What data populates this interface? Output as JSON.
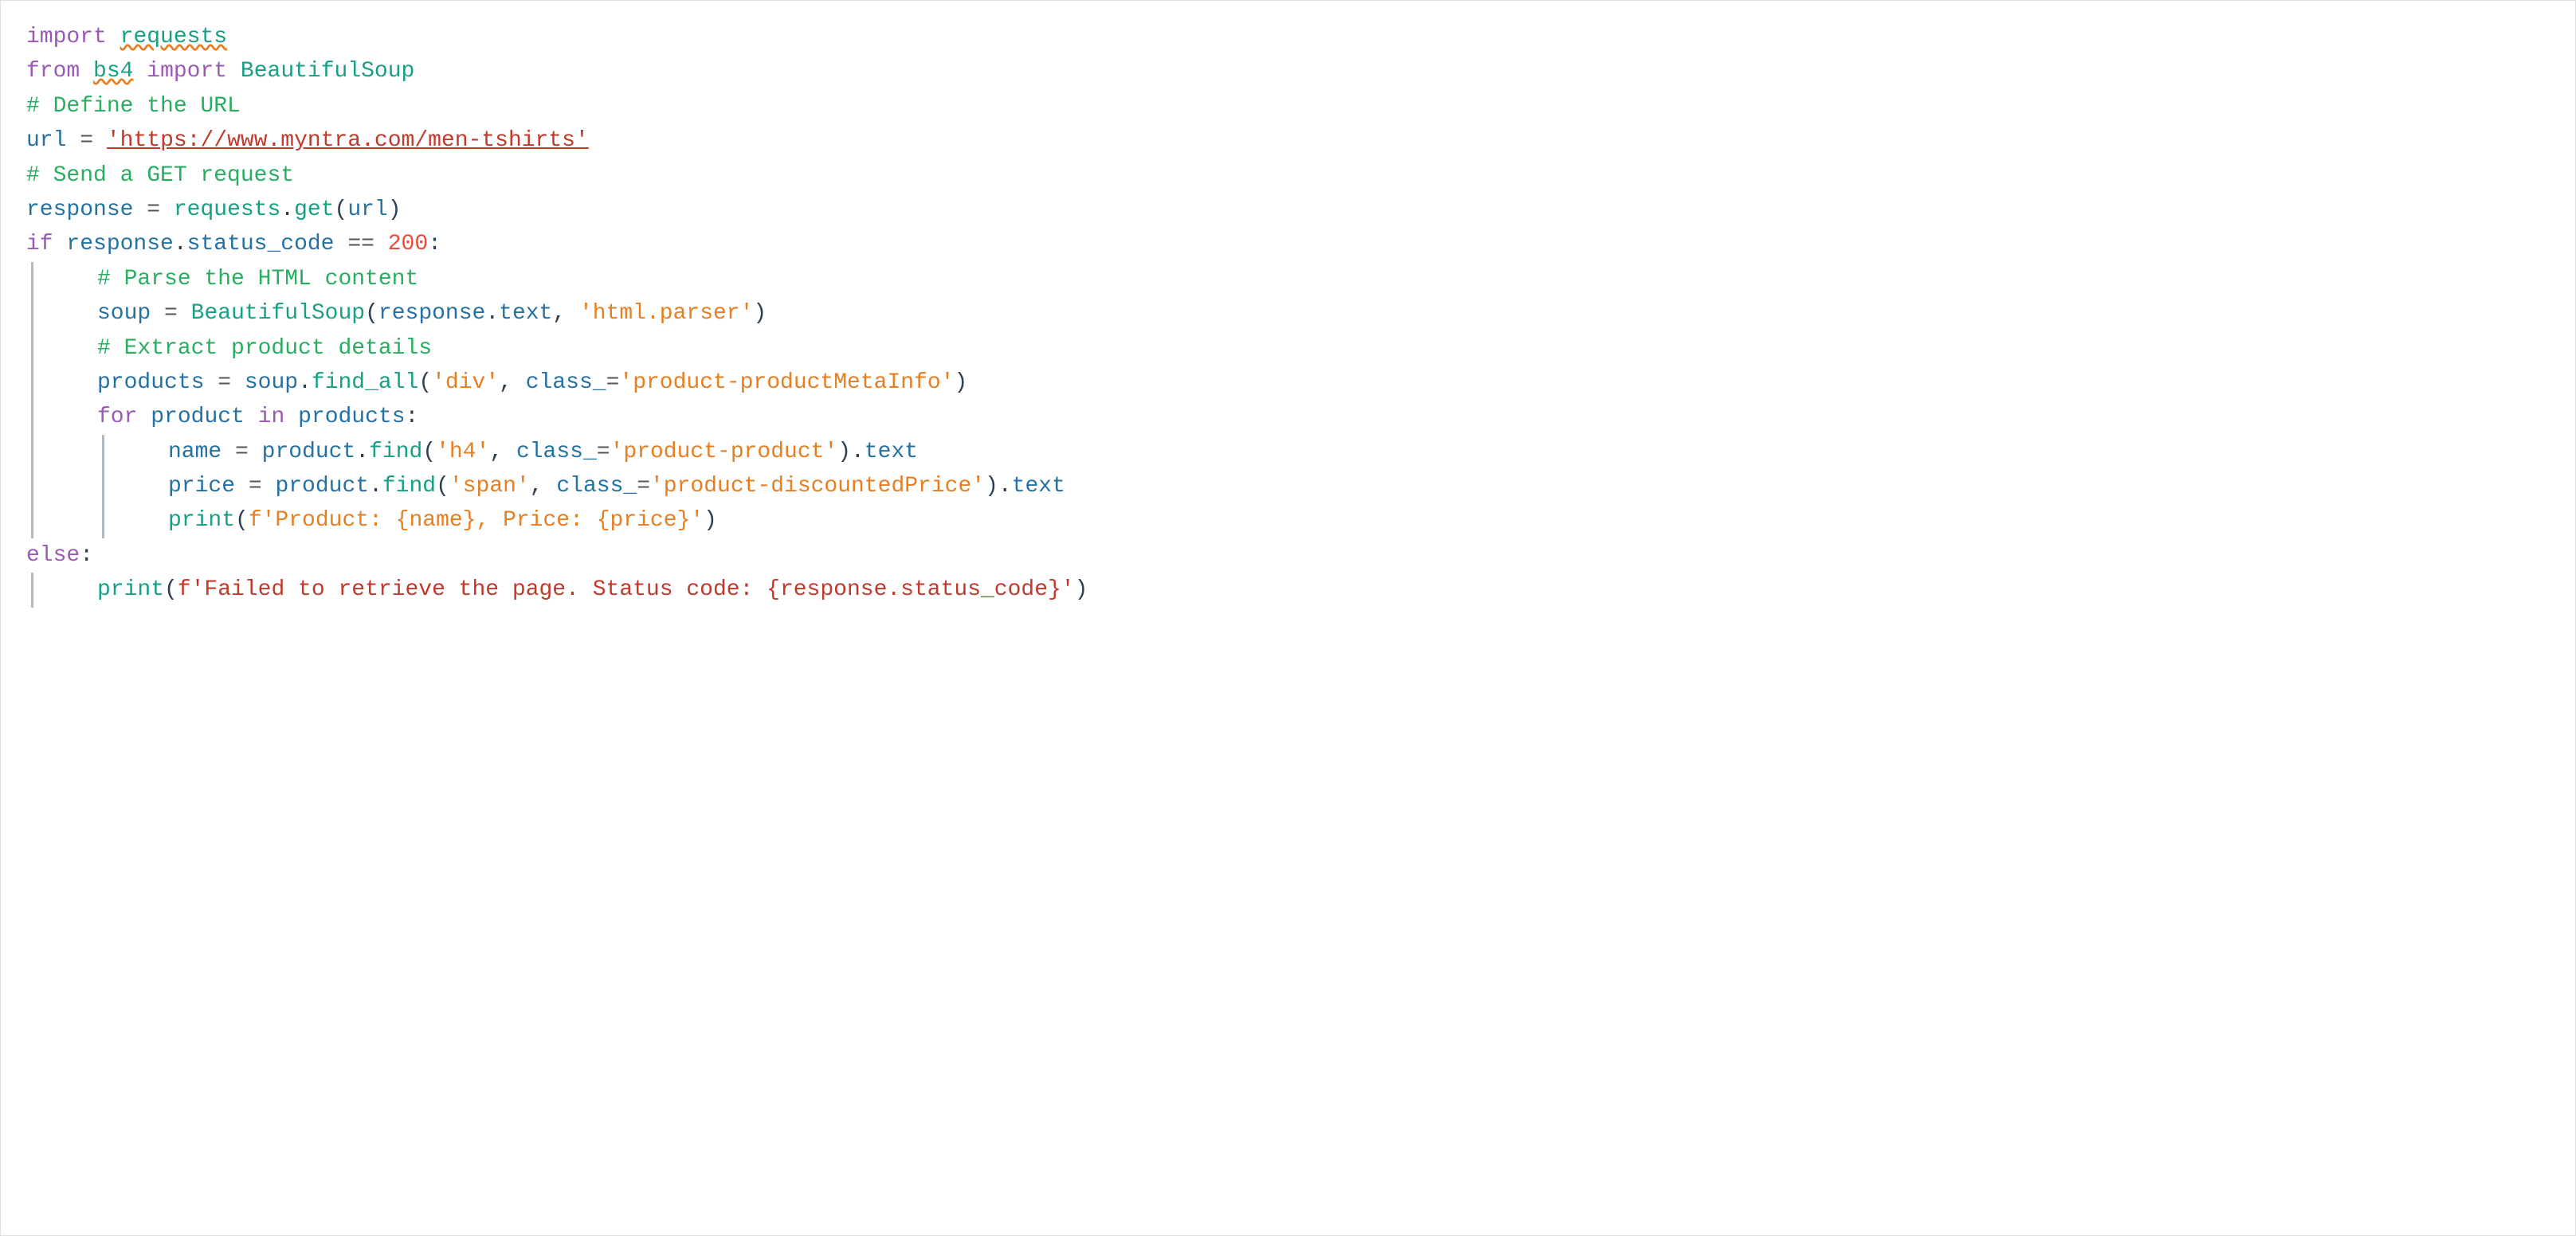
{
  "code": {
    "lines": [
      {
        "id": "line1",
        "indent": "",
        "tokens": [
          {
            "type": "kw-purple",
            "text": "import"
          },
          {
            "type": "plain",
            "text": " "
          },
          {
            "type": "name-teal",
            "text": "requests",
            "squiggle": true
          }
        ]
      },
      {
        "id": "line2",
        "indent": "",
        "tokens": [
          {
            "type": "kw-purple",
            "text": "from"
          },
          {
            "type": "plain",
            "text": " "
          },
          {
            "type": "name-teal",
            "text": "bs4",
            "squiggle": true
          },
          {
            "type": "plain",
            "text": " "
          },
          {
            "type": "kw-purple",
            "text": "import"
          },
          {
            "type": "plain",
            "text": " "
          },
          {
            "type": "name-teal",
            "text": "BeautifulSoup"
          }
        ]
      },
      {
        "id": "line3",
        "indent": "",
        "tokens": [
          {
            "type": "comment",
            "text": "# Define the URL"
          }
        ]
      },
      {
        "id": "line4",
        "indent": "",
        "tokens": [
          {
            "type": "name-blue",
            "text": "url"
          },
          {
            "type": "plain",
            "text": " "
          },
          {
            "type": "op",
            "text": "="
          },
          {
            "type": "plain",
            "text": " "
          },
          {
            "type": "str-red",
            "text": "'https://www.myntra.com/men-tshirts'",
            "underline": true
          }
        ]
      },
      {
        "id": "line5",
        "indent": "",
        "tokens": [
          {
            "type": "comment",
            "text": "# Send a GET request"
          }
        ]
      },
      {
        "id": "line6",
        "indent": "",
        "tokens": [
          {
            "type": "name-blue",
            "text": "response"
          },
          {
            "type": "plain",
            "text": " "
          },
          {
            "type": "op",
            "text": "="
          },
          {
            "type": "plain",
            "text": " "
          },
          {
            "type": "name-teal",
            "text": "requests"
          },
          {
            "type": "plain",
            "text": "."
          },
          {
            "type": "name-teal",
            "text": "get"
          },
          {
            "type": "plain",
            "text": "("
          },
          {
            "type": "name-blue",
            "text": "url"
          },
          {
            "type": "plain",
            "text": ")"
          }
        ]
      },
      {
        "id": "line7",
        "indent": "",
        "tokens": [
          {
            "type": "kw-purple",
            "text": "if"
          },
          {
            "type": "plain",
            "text": " "
          },
          {
            "type": "name-blue",
            "text": "response"
          },
          {
            "type": "plain",
            "text": "."
          },
          {
            "type": "name-blue",
            "text": "status_code"
          },
          {
            "type": "plain",
            "text": " "
          },
          {
            "type": "op",
            "text": "=="
          },
          {
            "type": "plain",
            "text": " "
          },
          {
            "type": "num",
            "text": "200"
          },
          {
            "type": "plain",
            "text": ":"
          }
        ]
      },
      {
        "id": "line8",
        "indent": "1",
        "border": true,
        "tokens": [
          {
            "type": "comment",
            "text": "# Parse the HTML content"
          }
        ]
      },
      {
        "id": "line9",
        "indent": "1",
        "border": true,
        "tokens": [
          {
            "type": "name-blue",
            "text": "soup"
          },
          {
            "type": "plain",
            "text": " "
          },
          {
            "type": "op",
            "text": "="
          },
          {
            "type": "plain",
            "text": " "
          },
          {
            "type": "name-teal",
            "text": "BeautifulSoup"
          },
          {
            "type": "plain",
            "text": "("
          },
          {
            "type": "name-blue",
            "text": "response"
          },
          {
            "type": "plain",
            "text": "."
          },
          {
            "type": "name-blue",
            "text": "text"
          },
          {
            "type": "plain",
            "text": ", "
          },
          {
            "type": "str-orange",
            "text": "'html.parser'"
          },
          {
            "type": "plain",
            "text": ")"
          }
        ]
      },
      {
        "id": "line10",
        "indent": "1",
        "border": true,
        "tokens": [
          {
            "type": "comment",
            "text": "# Extract product details"
          }
        ]
      },
      {
        "id": "line11",
        "indent": "1",
        "border": true,
        "tokens": [
          {
            "type": "name-blue",
            "text": "products"
          },
          {
            "type": "plain",
            "text": " "
          },
          {
            "type": "op",
            "text": "="
          },
          {
            "type": "plain",
            "text": " "
          },
          {
            "type": "name-blue",
            "text": "soup"
          },
          {
            "type": "plain",
            "text": "."
          },
          {
            "type": "name-teal",
            "text": "find_all"
          },
          {
            "type": "plain",
            "text": "("
          },
          {
            "type": "str-orange",
            "text": "'div'"
          },
          {
            "type": "plain",
            "text": ", "
          },
          {
            "type": "name-blue",
            "text": "class_"
          },
          {
            "type": "op",
            "text": "="
          },
          {
            "type": "str-orange",
            "text": "'product-productMetaInfo'"
          },
          {
            "type": "plain",
            "text": ")"
          }
        ]
      },
      {
        "id": "line12",
        "indent": "1",
        "border": true,
        "tokens": [
          {
            "type": "kw-purple",
            "text": "for"
          },
          {
            "type": "plain",
            "text": " "
          },
          {
            "type": "name-blue",
            "text": "product"
          },
          {
            "type": "plain",
            "text": " "
          },
          {
            "type": "kw-purple",
            "text": "in"
          },
          {
            "type": "plain",
            "text": " "
          },
          {
            "type": "name-blue",
            "text": "products"
          },
          {
            "type": "plain",
            "text": ":"
          }
        ]
      },
      {
        "id": "line13",
        "indent": "2",
        "border": true,
        "border2": true,
        "tokens": [
          {
            "type": "name-blue",
            "text": "name"
          },
          {
            "type": "plain",
            "text": " "
          },
          {
            "type": "op",
            "text": "="
          },
          {
            "type": "plain",
            "text": " "
          },
          {
            "type": "name-blue",
            "text": "product"
          },
          {
            "type": "plain",
            "text": "."
          },
          {
            "type": "name-teal",
            "text": "find"
          },
          {
            "type": "plain",
            "text": "("
          },
          {
            "type": "str-orange",
            "text": "'h4'"
          },
          {
            "type": "plain",
            "text": ", "
          },
          {
            "type": "name-blue",
            "text": "class_"
          },
          {
            "type": "op",
            "text": "="
          },
          {
            "type": "str-orange",
            "text": "'product-product'"
          },
          {
            "type": "plain",
            "text": ")."
          },
          {
            "type": "name-blue",
            "text": "text"
          }
        ]
      },
      {
        "id": "line14",
        "indent": "2",
        "border": true,
        "border2": true,
        "tokens": [
          {
            "type": "name-blue",
            "text": "price"
          },
          {
            "type": "plain",
            "text": " "
          },
          {
            "type": "op",
            "text": "="
          },
          {
            "type": "plain",
            "text": " "
          },
          {
            "type": "name-blue",
            "text": "product"
          },
          {
            "type": "plain",
            "text": "."
          },
          {
            "type": "name-teal",
            "text": "find"
          },
          {
            "type": "plain",
            "text": "("
          },
          {
            "type": "str-orange",
            "text": "'span'"
          },
          {
            "type": "plain",
            "text": ", "
          },
          {
            "type": "name-blue",
            "text": "class_"
          },
          {
            "type": "op",
            "text": "="
          },
          {
            "type": "str-orange",
            "text": "'product-discountedPrice'"
          },
          {
            "type": "plain",
            "text": ")."
          },
          {
            "type": "name-blue",
            "text": "text"
          }
        ]
      },
      {
        "id": "line15",
        "indent": "2",
        "border": true,
        "border2": true,
        "tokens": [
          {
            "type": "name-teal",
            "text": "print"
          },
          {
            "type": "plain",
            "text": "("
          },
          {
            "type": "str-orange",
            "text": "f'Product: {name}, Price: {price}'"
          },
          {
            "type": "plain",
            "text": ")"
          }
        ]
      },
      {
        "id": "line16",
        "indent": "",
        "tokens": [
          {
            "type": "kw-purple",
            "text": "else"
          },
          {
            "type": "plain",
            "text": ":"
          }
        ]
      },
      {
        "id": "line17",
        "indent": "1",
        "border": true,
        "tokens": [
          {
            "type": "name-teal",
            "text": "print"
          },
          {
            "type": "plain",
            "text": "("
          },
          {
            "type": "str-red",
            "text": "f'Failed to retrieve the page. Status code: {response.status_code}'"
          },
          {
            "type": "plain",
            "text": ")"
          }
        ]
      }
    ]
  }
}
